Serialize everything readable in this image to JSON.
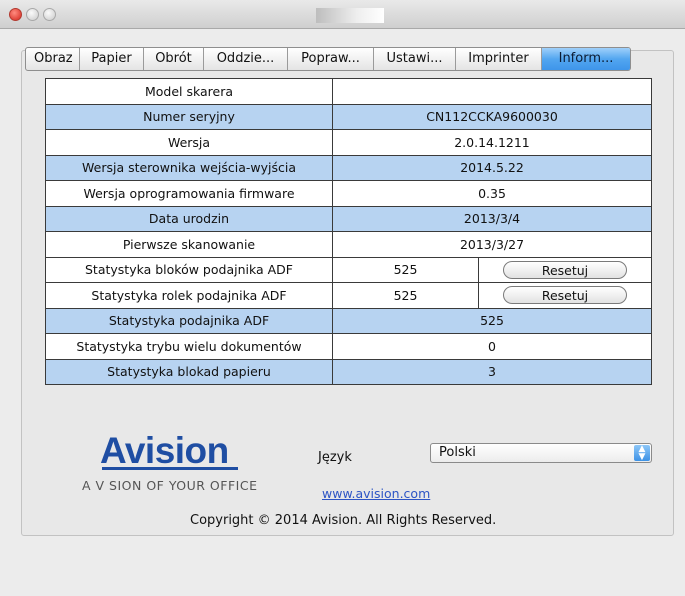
{
  "tabs": [
    {
      "label": "Obraz",
      "active": false
    },
    {
      "label": "Papier",
      "active": false
    },
    {
      "label": "Obrót",
      "active": false
    },
    {
      "label": "Oddzie...",
      "active": false
    },
    {
      "label": "Popraw...",
      "active": false
    },
    {
      "label": "Ustawi...",
      "active": false
    },
    {
      "label": "Imprinter",
      "active": false
    },
    {
      "label": "Inform...",
      "active": true
    }
  ],
  "info_rows": [
    {
      "label": "Model skarera",
      "value": ""
    },
    {
      "label": "Numer seryjny",
      "value": "CN112CCKA9600030"
    },
    {
      "label": "Wersja",
      "value": "2.0.14.1211"
    },
    {
      "label": "Wersja sterownika wejścia-wyjścia",
      "value": "2014.5.22"
    },
    {
      "label": "Wersja oprogramowania firmware",
      "value": "0.35"
    },
    {
      "label": "Data urodzin",
      "value": "2013/3/4"
    },
    {
      "label": "Pierwsze skanowanie",
      "value": "2013/3/27"
    },
    {
      "label": "Statystyka bloków podajnika ADF",
      "value": "525",
      "button": "Resetuj"
    },
    {
      "label": "Statystyka rolek podajnika ADF",
      "value": "525",
      "button": "Resetuj"
    },
    {
      "label": "Statystyka podajnika ADF",
      "value": "525"
    },
    {
      "label": "Statystyka trybu wielu dokumentów",
      "value": "0"
    },
    {
      "label": "Statystyka blokad papieru",
      "value": "3"
    }
  ],
  "logo": {
    "text": "Avision",
    "tagline": "A V SION OF YOUR OFFICE"
  },
  "language": {
    "label": "Język",
    "selected": "Polski"
  },
  "website": "www.avision.com",
  "copyright": "Copyright © 2014 Avision. All Rights Reserved.",
  "colors": {
    "row_blue": "#b7d3f1",
    "row_white": "#ffffff",
    "tab_active": "#53a6f0",
    "brand": "#1f4ea3"
  }
}
